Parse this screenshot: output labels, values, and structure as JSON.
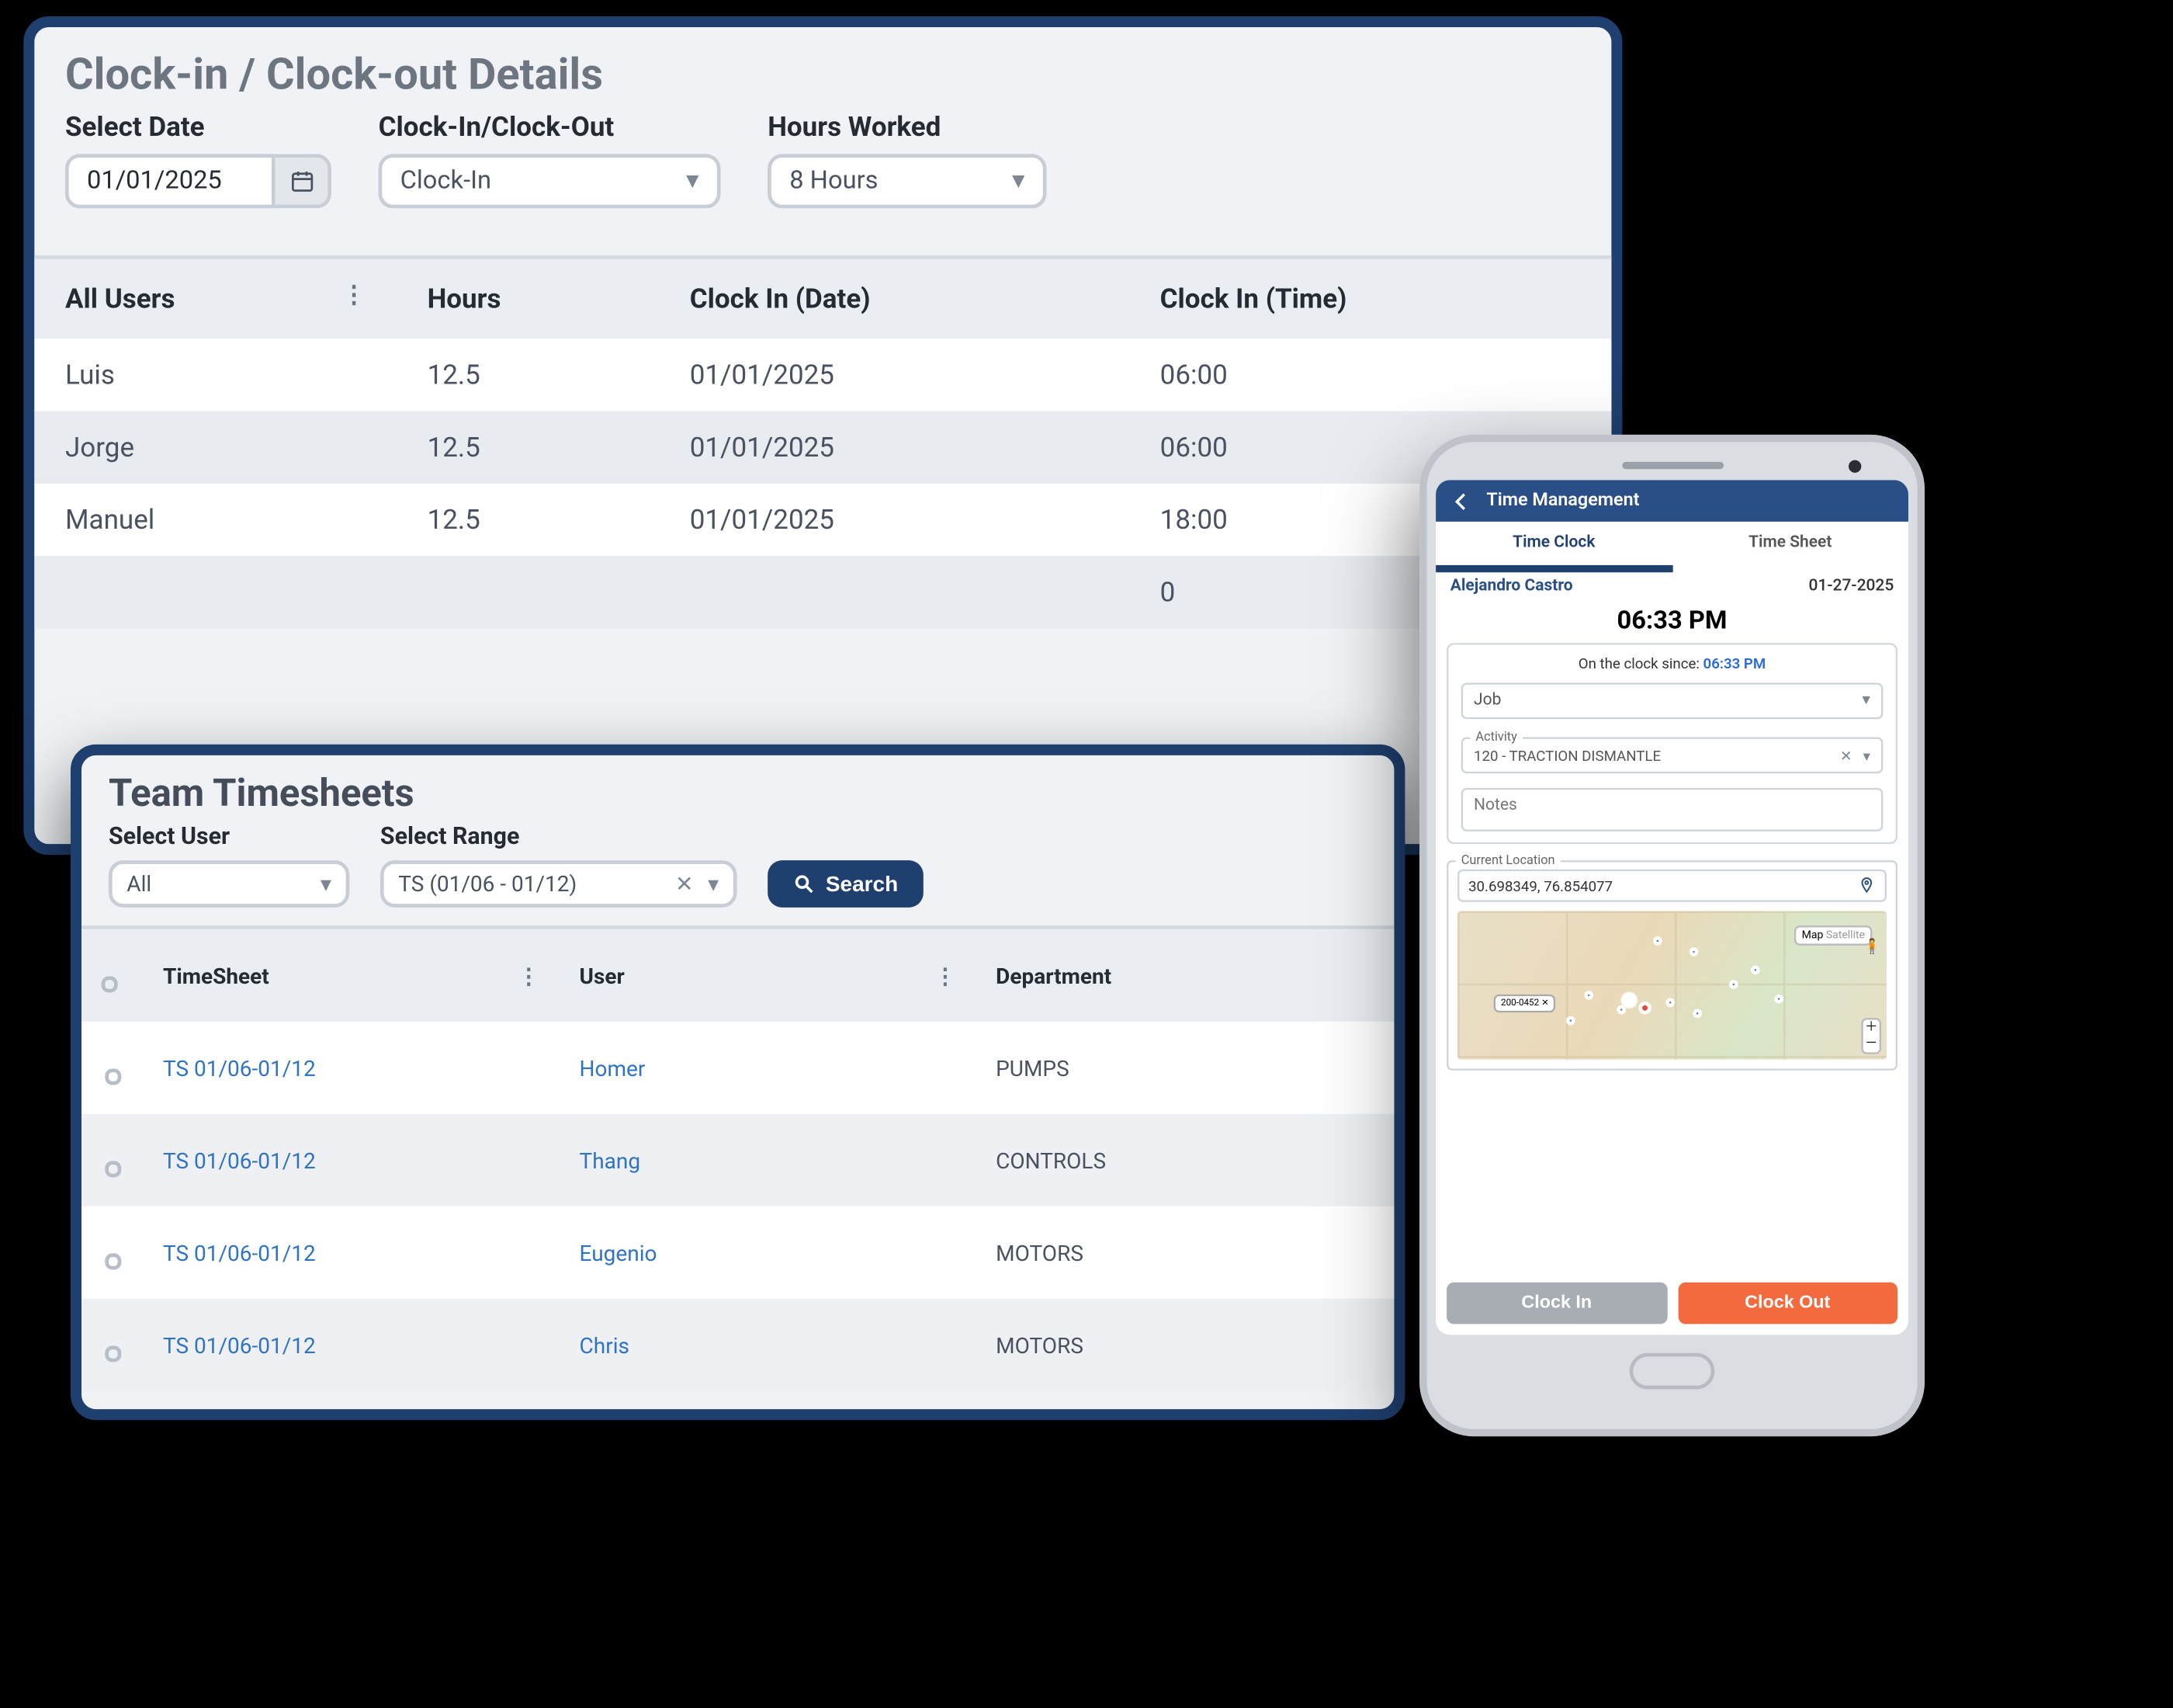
{
  "clock": {
    "title": "Clock-in / Clock-out Details",
    "labels": {
      "date": "Select Date",
      "inout": "Clock-In/Clock-Out",
      "hours": "Hours Worked"
    },
    "values": {
      "date": "01/01/2025",
      "inout": "Clock-In",
      "hours": "8 Hours"
    },
    "columns": [
      "All Users",
      "Hours",
      "Clock In (Date)",
      "Clock In (Time)"
    ],
    "rows": [
      {
        "user": "Luis",
        "hours": "12.5",
        "date": "01/01/2025",
        "time": "06:00"
      },
      {
        "user": "Jorge",
        "hours": "12.5",
        "date": "01/01/2025",
        "time": "06:00"
      },
      {
        "user": "Manuel",
        "hours": "12.5",
        "date": "01/01/2025",
        "time": "18:00"
      },
      {
        "user": "",
        "hours": "",
        "date": "",
        "time": "0"
      }
    ]
  },
  "team": {
    "title": "Team Timesheets",
    "labels": {
      "user": "Select User",
      "range": "Select Range"
    },
    "values": {
      "user": "All",
      "range": "TS (01/06 - 01/12)"
    },
    "search": "Search",
    "columns": [
      "TimeSheet",
      "User",
      "Department"
    ],
    "rows": [
      {
        "ts": "TS 01/06-01/12",
        "user": "Homer",
        "dept": "PUMPS"
      },
      {
        "ts": "TS 01/06-01/12",
        "user": "Thang",
        "dept": "CONTROLS"
      },
      {
        "ts": "TS 01/06-01/12",
        "user": "Eugenio",
        "dept": "MOTORS"
      },
      {
        "ts": "TS 01/06-01/12",
        "user": "Chris",
        "dept": "MOTORS"
      }
    ]
  },
  "phone": {
    "header": "Time Management",
    "tabs": {
      "clock": "Time Clock",
      "sheet": "Time Sheet"
    },
    "employee": "Alejandro Castro",
    "date": "01-27-2025",
    "time": "06:33 PM",
    "since_label": "On the clock since:",
    "since_time": "06:33 PM",
    "job_label": "Job",
    "activity_label": "Activity",
    "activity_value": "120 - TRACTION DISMANTLE",
    "notes_label": "Notes",
    "location_label": "Current Location",
    "location_value": "30.698349, 76.854077",
    "map_toggle": {
      "map": "Map",
      "sat": "Satellite"
    },
    "buttons": {
      "in": "Clock In",
      "out": "Clock Out"
    }
  }
}
